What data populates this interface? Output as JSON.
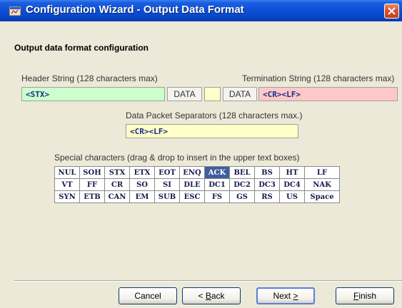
{
  "window": {
    "title": "Configuration Wizard - Output Data Format"
  },
  "page": {
    "heading": "Output data format configuration"
  },
  "header_string": {
    "label": "Header String (128 characters max)",
    "value": "<STX>"
  },
  "termination_string": {
    "label": "Termination String (128 characters max)",
    "value": "<CR><LF>"
  },
  "data_segment": {
    "left_label": "DATA",
    "right_label": "DATA"
  },
  "packet_separators": {
    "label": "Data Packet Separators (128 characters max.)",
    "value": "<CR><LF>"
  },
  "special_chars": {
    "label": "Special characters (drag & drop to insert in the upper text boxes)",
    "selected": "ACK",
    "rows": [
      [
        "NUL",
        "SOH",
        "STX",
        "ETX",
        "EOT",
        "ENQ",
        "ACK",
        "BEL",
        "BS",
        "HT",
        "LF"
      ],
      [
        "VT",
        "FF",
        "CR",
        "SO",
        "SI",
        "DLE",
        "DC1",
        "DC2",
        "DC3",
        "DC4",
        "NAK"
      ],
      [
        "SYN",
        "ETB",
        "CAN",
        "EM",
        "SUB",
        "ESC",
        "FS",
        "GS",
        "RS",
        "US",
        "Space"
      ]
    ]
  },
  "buttons": {
    "cancel": "Cancel",
    "back_mnemonic": "B",
    "back_rest": "ack",
    "back_arrow": "<",
    "next_text": "Next",
    "next_arrow": ">",
    "finish_mnemonic": "F",
    "finish_rest": "inish"
  },
  "colors": {
    "title_bar": "#0a4fd6",
    "header_field": "#ccffcc",
    "termination_field": "#ffc8c8",
    "separator_field": "#ffffc8",
    "selected_cell": "#3d5f9e"
  }
}
